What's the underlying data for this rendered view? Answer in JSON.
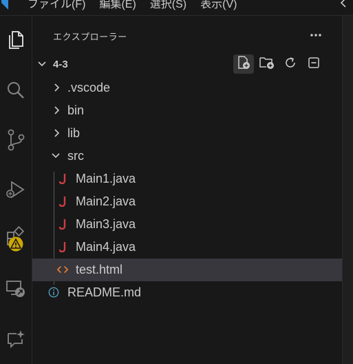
{
  "menubar": {
    "items": [
      "ファイル(F)",
      "編集(E)",
      "選択(S)",
      "表示(V)"
    ]
  },
  "activity": {
    "items": [
      {
        "name": "explorer-icon",
        "active": true
      },
      {
        "name": "search-icon",
        "active": false
      },
      {
        "name": "source-control-icon",
        "active": false
      },
      {
        "name": "run-debug-icon",
        "active": false
      },
      {
        "name": "extensions-icon",
        "active": false
      },
      {
        "name": "remote-explorer-icon",
        "active": false
      },
      {
        "name": "chat-icon",
        "active": false
      }
    ],
    "warning_badge_color": "#cca700"
  },
  "sidebar": {
    "title": "エクスプローラー",
    "more_label": "…",
    "folder": {
      "name": "4-3",
      "actions": [
        "new-file-icon",
        "new-folder-icon",
        "refresh-icon",
        "collapse-all-icon"
      ]
    },
    "tree": [
      {
        "label": ".vscode",
        "kind": "folder",
        "expanded": false,
        "depth": 1
      },
      {
        "label": "bin",
        "kind": "folder",
        "expanded": false,
        "depth": 1
      },
      {
        "label": "lib",
        "kind": "folder",
        "expanded": false,
        "depth": 1
      },
      {
        "label": "src",
        "kind": "folder",
        "expanded": true,
        "depth": 1
      },
      {
        "label": "Main1.java",
        "kind": "java",
        "depth": 2
      },
      {
        "label": "Main2.java",
        "kind": "java",
        "depth": 2
      },
      {
        "label": "Main3.java",
        "kind": "java",
        "depth": 2
      },
      {
        "label": "Main4.java",
        "kind": "java",
        "depth": 2
      },
      {
        "label": "test.html",
        "kind": "html",
        "depth": 2,
        "selected": true
      },
      {
        "label": "README.md",
        "kind": "info",
        "depth": 1
      }
    ]
  },
  "colors": {
    "background": "#181818",
    "java_icon": "#cc3e44",
    "html_icon": "#e37933",
    "info_icon": "#519aba",
    "selection": "#37373d"
  }
}
